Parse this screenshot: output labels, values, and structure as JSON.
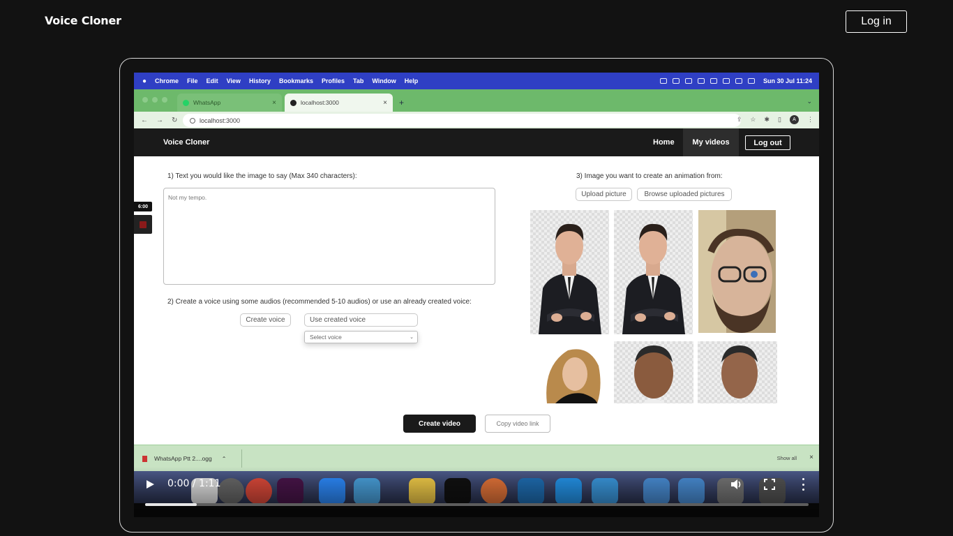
{
  "header": {
    "brand": "Voice Cloner",
    "login_label": "Log in"
  },
  "video": {
    "menubar": {
      "items": [
        "Chrome",
        "File",
        "Edit",
        "View",
        "History",
        "Bookmarks",
        "Profiles",
        "Tab",
        "Window",
        "Help"
      ],
      "clock": "Sun 30 Jul  11:24"
    },
    "browser": {
      "tabs": [
        {
          "title": "WhatsApp",
          "close": "×"
        },
        {
          "title": "localhost:3000",
          "close": "×"
        }
      ],
      "new_tab": "+",
      "url": "localhost:3000",
      "profile_initial": "A"
    },
    "app": {
      "brand": "Voice Cloner",
      "nav_home": "Home",
      "nav_my_videos": "My videos",
      "nav_logout": "Log out",
      "step1_label": "1) Text you would like the image to say (Max 340 characters):",
      "text_value": "Not my tempo.",
      "step2_label": "2) Create a voice using some audios (recommended 5-10 audios) or use an already created voice:",
      "create_voice": "Create voice",
      "use_created_voice": "Use created voice",
      "select_voice": "Select voice",
      "step3_label": "3) Image you want to create an animation from:",
      "upload_picture": "Upload picture",
      "browse_pictures": "Browse uploaded pictures",
      "create_video": "Create video",
      "copy_video_link": "Copy video link"
    },
    "recorder": {
      "timer": "6:00"
    },
    "downloads": {
      "file": "WhatsApp Ptt 2....ogg",
      "show_all": "Show all",
      "close": "×"
    },
    "controls": {
      "time": "0:00 / 1:11",
      "progress_fraction": 0.078
    }
  }
}
